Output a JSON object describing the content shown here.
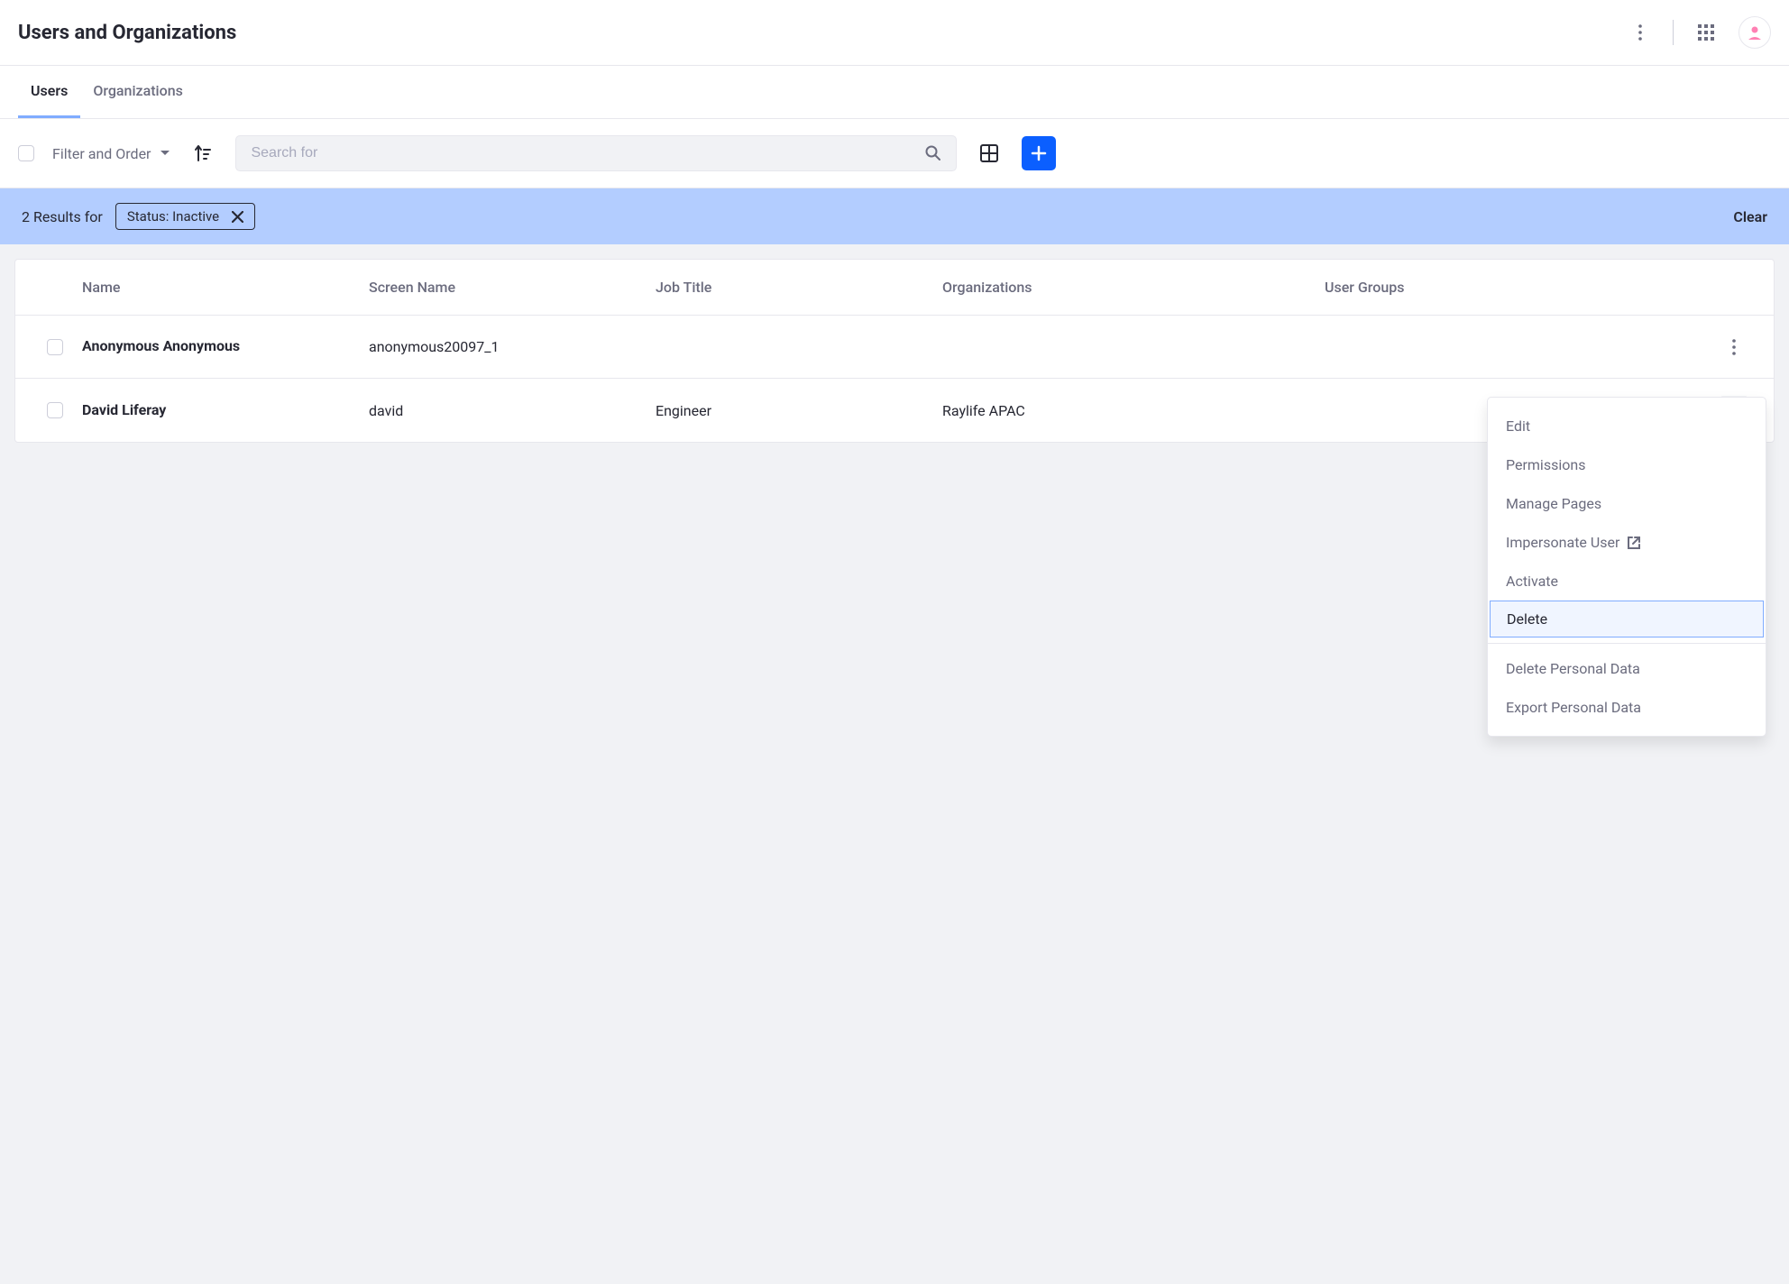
{
  "header": {
    "title": "Users and Organizations"
  },
  "tabs": [
    {
      "label": "Users",
      "active": true
    },
    {
      "label": "Organizations",
      "active": false
    }
  ],
  "toolbar": {
    "filter_label": "Filter and Order",
    "search_placeholder": "Search for"
  },
  "filter_results": {
    "count_text": "2 Results for",
    "chip_text": "Status: Inactive",
    "clear_text": "Clear"
  },
  "table": {
    "headers": [
      "Name",
      "Screen Name",
      "Job Title",
      "Organizations",
      "User Groups"
    ],
    "rows": [
      {
        "name": "Anonymous Anonymous",
        "screen_name": "anonymous20097_1",
        "job_title": "",
        "organizations": "",
        "user_groups": ""
      },
      {
        "name": "David Liferay",
        "screen_name": "david",
        "job_title": "Engineer",
        "organizations": "Raylife APAC",
        "user_groups": ""
      }
    ]
  },
  "dropdown": {
    "items": [
      {
        "label": "Edit"
      },
      {
        "label": "Permissions"
      },
      {
        "label": "Manage Pages"
      },
      {
        "label": "Impersonate User",
        "external": true
      },
      {
        "label": "Activate"
      },
      {
        "label": "Delete",
        "highlighted": true
      }
    ],
    "items2": [
      {
        "label": "Delete Personal Data"
      },
      {
        "label": "Export Personal Data"
      }
    ]
  }
}
